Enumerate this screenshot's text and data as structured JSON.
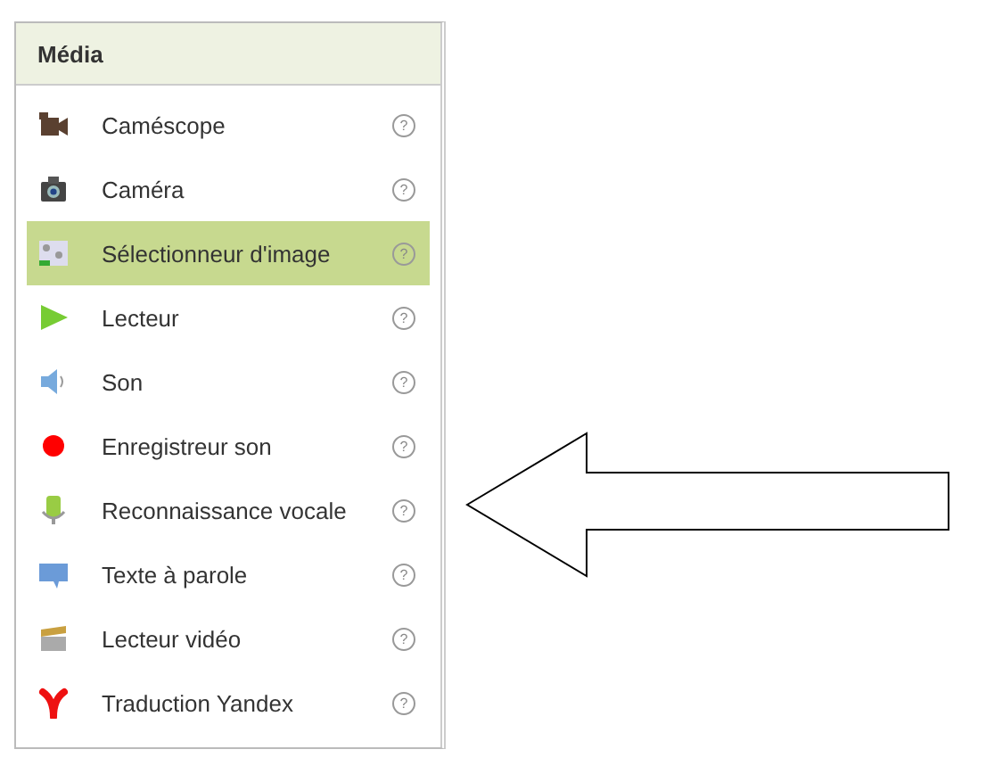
{
  "panel": {
    "title": "Média",
    "items": [
      {
        "kind": "camcorder",
        "label": "Caméscope",
        "help": "?",
        "selected": false
      },
      {
        "kind": "camera",
        "label": "Caméra",
        "help": "?",
        "selected": false
      },
      {
        "kind": "imagepicker",
        "label": "Sélectionneur d'image",
        "help": "?",
        "selected": true
      },
      {
        "kind": "player",
        "label": "Lecteur",
        "help": "?",
        "selected": false
      },
      {
        "kind": "sound",
        "label": "Son",
        "help": "?",
        "selected": false
      },
      {
        "kind": "recorder",
        "label": "Enregistreur son",
        "help": "?",
        "selected": false
      },
      {
        "kind": "speech",
        "label": "Reconnaissance vocale",
        "help": "?",
        "selected": false
      },
      {
        "kind": "tts",
        "label": "Texte à parole",
        "help": "?",
        "selected": false
      },
      {
        "kind": "video",
        "label": "Lecteur vidéo",
        "help": "?",
        "selected": false
      },
      {
        "kind": "yandex",
        "label": "Traduction Yandex",
        "help": "?",
        "selected": false
      }
    ]
  }
}
